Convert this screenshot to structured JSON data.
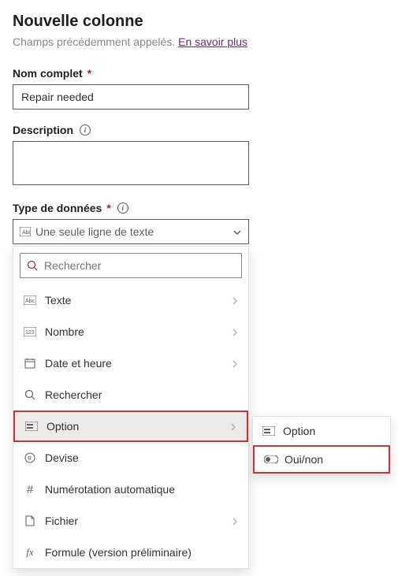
{
  "header": {
    "title": "Nouvelle colonne",
    "subtitle_prefix": "Champs précédemment appelés. ",
    "subtitle_link": "En savoir plus"
  },
  "fields": {
    "display_name": {
      "label": "Nom complet",
      "value": "Repair needed"
    },
    "description": {
      "label": "Description",
      "value": ""
    },
    "data_type": {
      "label": "Type de données",
      "selected": "Une seule ligne de texte",
      "search_placeholder": "Rechercher",
      "options": [
        {
          "icon": "text",
          "label": "Texte",
          "has_submenu": true
        },
        {
          "icon": "number",
          "label": "Nombre",
          "has_submenu": true
        },
        {
          "icon": "datetime",
          "label": "Date et heure",
          "has_submenu": true
        },
        {
          "icon": "lookup",
          "label": "Rechercher",
          "has_submenu": false
        },
        {
          "icon": "choice",
          "label": "Option",
          "has_submenu": true,
          "highlighted": true
        },
        {
          "icon": "currency",
          "label": "Devise",
          "has_submenu": false
        },
        {
          "icon": "autonumber",
          "label": "Numérotation automatique",
          "has_submenu": false
        },
        {
          "icon": "file",
          "label": "Fichier",
          "has_submenu": true
        },
        {
          "icon": "formula",
          "label": "Formule (version préliminaire)",
          "has_submenu": false
        }
      ],
      "submenu": [
        {
          "icon": "choice",
          "label": "Option",
          "highlighted": false
        },
        {
          "icon": "yesno",
          "label": "Oui/non",
          "highlighted": true
        }
      ]
    }
  }
}
